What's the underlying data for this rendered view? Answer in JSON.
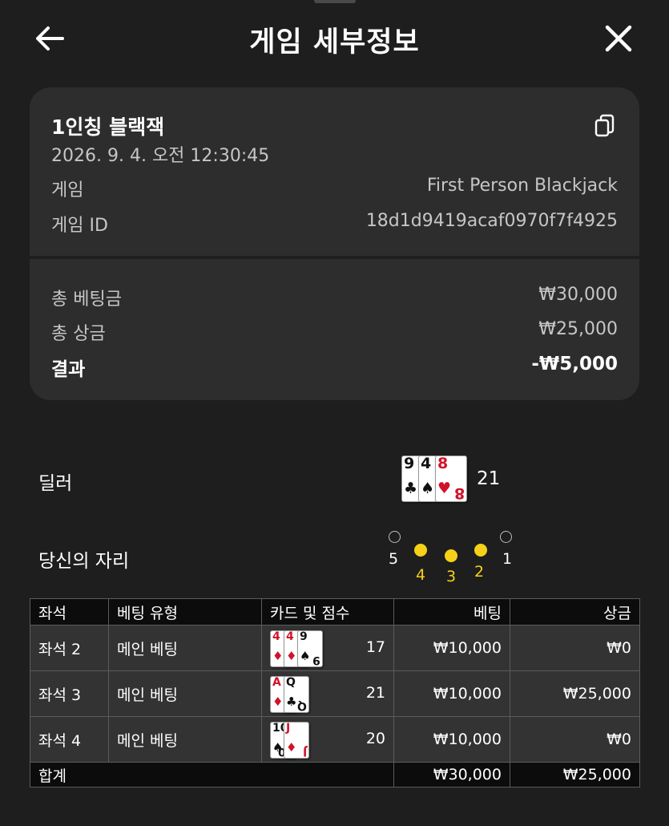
{
  "header": {
    "title": "게임 세부정보"
  },
  "summary": {
    "game_name": "1인칭 블랙잭",
    "timestamp": "2026. 9. 4. 오전 12:30:45",
    "game_label": "게임",
    "game_value": "First Person Blackjack",
    "game_id_label": "게임 ID",
    "game_id_value": "18d1d9419acaf0970f7f4925",
    "total_bet_label": "총 베팅금",
    "total_bet_value": "₩30,000",
    "total_prize_label": "총 상금",
    "total_prize_value": "₩25,000",
    "result_label": "결과",
    "result_value": "-₩5,000"
  },
  "dealer": {
    "label": "딜러",
    "score": "21",
    "cards": [
      {
        "rank": "9",
        "suit": "♣",
        "color": "black"
      },
      {
        "rank": "4",
        "suit": "♠",
        "color": "black"
      },
      {
        "rank": "8",
        "suit": "♥",
        "color": "red"
      }
    ]
  },
  "seats": {
    "label": "당신의 자리",
    "numbers": [
      "5",
      "4",
      "3",
      "2",
      "1"
    ],
    "active": [
      "4",
      "3",
      "2"
    ],
    "active_color": "#f7d117"
  },
  "table": {
    "headers": {
      "seat": "좌석",
      "bet_type": "베팅 유형",
      "cards": "카드 및 점수",
      "bet": "베팅",
      "prize": "상금"
    },
    "rows": [
      {
        "seat": "좌석 2",
        "bet_type": "메인 베팅",
        "score": "17",
        "bet": "₩10,000",
        "prize": "₩0",
        "cards": [
          {
            "rank": "4",
            "suit": "♦",
            "color": "red"
          },
          {
            "rank": "4",
            "suit": "♦",
            "color": "red"
          },
          {
            "rank": "9",
            "suit": "♠",
            "color": "black"
          }
        ]
      },
      {
        "seat": "좌석 3",
        "bet_type": "메인 베팅",
        "score": "21",
        "bet": "₩10,000",
        "prize": "₩25,000",
        "cards": [
          {
            "rank": "A",
            "suit": "♦",
            "color": "red"
          },
          {
            "rank": "Q",
            "suit": "♣",
            "color": "black"
          }
        ]
      },
      {
        "seat": "좌석 4",
        "bet_type": "메인 베팅",
        "score": "20",
        "bet": "₩10,000",
        "prize": "₩0",
        "cards": [
          {
            "rank": "10",
            "suit": "♠",
            "color": "black"
          },
          {
            "rank": "J",
            "suit": "♦",
            "color": "red"
          }
        ]
      }
    ],
    "total": {
      "label": "합계",
      "bet": "₩30,000",
      "prize": "₩25,000"
    }
  },
  "icons": [
    "back-arrow-icon",
    "close-icon",
    "copy-icon"
  ]
}
